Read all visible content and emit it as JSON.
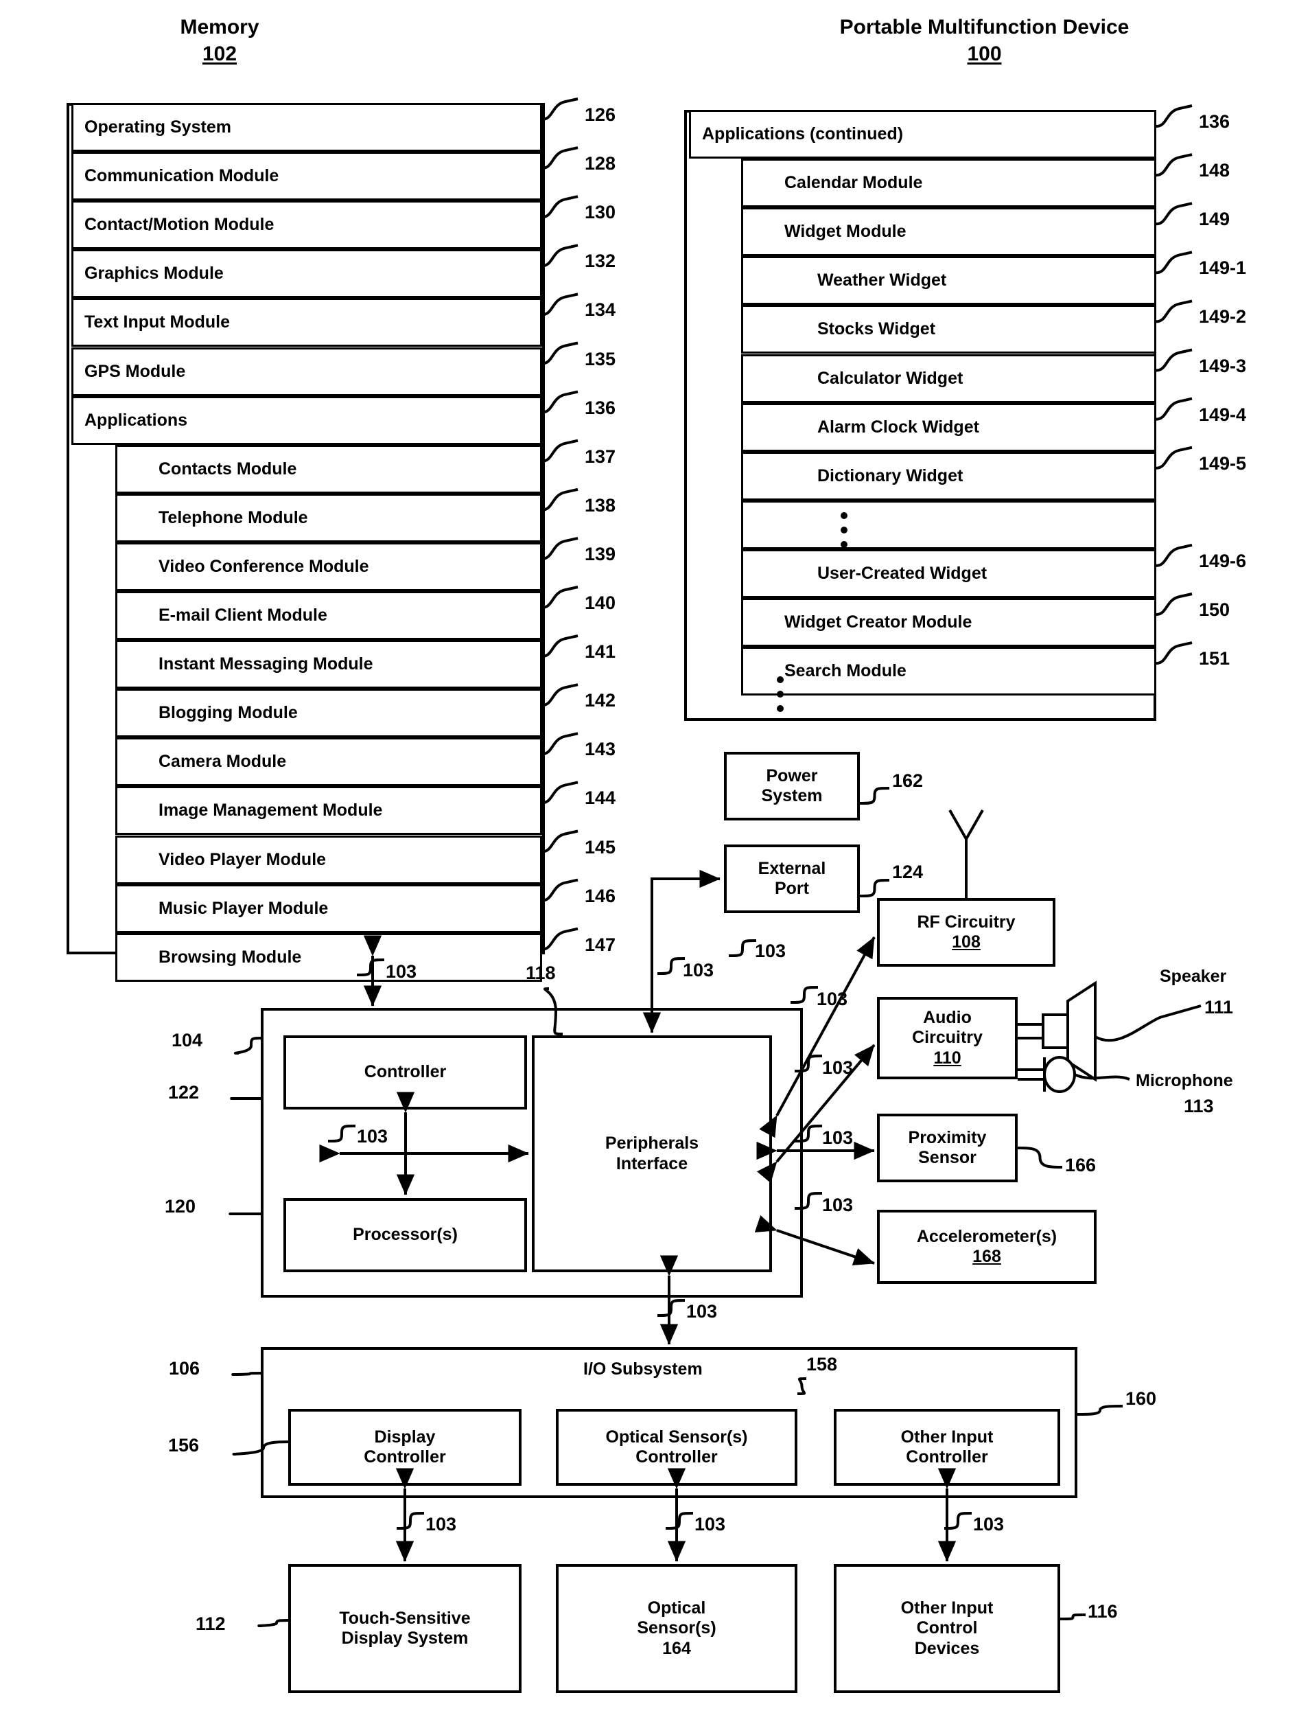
{
  "headings": {
    "memory": {
      "title": "Memory",
      "ref": "102"
    },
    "device": {
      "title": "Portable Multifunction Device",
      "ref": "100"
    }
  },
  "memory_panel": {
    "rows": [
      {
        "label": "Operating System",
        "ref": "126",
        "indent": 0
      },
      {
        "label": "Communication Module",
        "ref": "128",
        "indent": 0
      },
      {
        "label": "Contact/Motion Module",
        "ref": "130",
        "indent": 0
      },
      {
        "label": "Graphics Module",
        "ref": "132",
        "indent": 0
      },
      {
        "label": "Text Input Module",
        "ref": "134",
        "indent": 0
      },
      {
        "label": "GPS Module",
        "ref": "135",
        "indent": 0
      },
      {
        "label": "Applications",
        "ref": "136",
        "indent": 0
      },
      {
        "label": "Contacts Module",
        "ref": "137",
        "indent": 1
      },
      {
        "label": "Telephone Module",
        "ref": "138",
        "indent": 1
      },
      {
        "label": "Video Conference Module",
        "ref": "139",
        "indent": 1
      },
      {
        "label": "E-mail Client Module",
        "ref": "140",
        "indent": 1
      },
      {
        "label": "Instant Messaging Module",
        "ref": "141",
        "indent": 1
      },
      {
        "label": "Blogging Module",
        "ref": "142",
        "indent": 1
      },
      {
        "label": "Camera Module",
        "ref": "143",
        "indent": 1
      },
      {
        "label": "Image Management Module",
        "ref": "144",
        "indent": 1
      },
      {
        "label": "Video Player Module",
        "ref": "145",
        "indent": 1
      },
      {
        "label": "Music Player Module",
        "ref": "146",
        "indent": 1
      },
      {
        "label": "Browsing Module",
        "ref": "147",
        "indent": 1
      }
    ]
  },
  "applications_panel": {
    "rows": [
      {
        "label": "Applications (continued)",
        "ref": "136",
        "indent": 0
      },
      {
        "label": "Calendar Module",
        "ref": "148",
        "indent": 1
      },
      {
        "label": "Widget Module",
        "ref": "149",
        "indent": 1
      },
      {
        "label": "Weather Widget",
        "ref": "149-1",
        "indent": 2
      },
      {
        "label": "Stocks Widget",
        "ref": "149-2",
        "indent": 2
      },
      {
        "label": "Calculator Widget",
        "ref": "149-3",
        "indent": 2
      },
      {
        "label": "Alarm Clock Widget",
        "ref": "149-4",
        "indent": 2
      },
      {
        "label": "Dictionary Widget",
        "ref": "149-5",
        "indent": 2
      },
      {
        "label": "",
        "ref": "",
        "indent": 2,
        "ellipsis": true
      },
      {
        "label": "User-Created Widget",
        "ref": "149-6",
        "indent": 2
      },
      {
        "label": "Widget Creator Module",
        "ref": "150",
        "indent": 1
      },
      {
        "label": "Search Module",
        "ref": "151",
        "indent": 1
      }
    ]
  },
  "blocks": {
    "power_system": {
      "label": "Power\nSystem",
      "ref": "162"
    },
    "external_port": {
      "label": "External\nPort",
      "ref": "124"
    },
    "rf_circuitry": {
      "label": "RF Circuitry",
      "num": "108"
    },
    "audio_circuitry": {
      "label": "Audio\nCircuitry",
      "num": "110"
    },
    "proximity_sensor": {
      "label": "Proximity\nSensor",
      "ref": "166"
    },
    "accelerometers": {
      "label": "Accelerometer(s)",
      "num": "168"
    },
    "controller": {
      "label": "Controller",
      "ref": "122"
    },
    "processors": {
      "label": "Processor(s)",
      "ref": "120"
    },
    "peripherals": {
      "label": "Peripherals\nInterface",
      "ref": "118"
    },
    "cpu_group": {
      "ref": "104"
    },
    "io_subsystem": {
      "label": "I/O Subsystem",
      "ref": "158",
      "group_ref": "106"
    },
    "display_controller": {
      "label": "Display\nController",
      "ref": "156"
    },
    "optical_sensor_controller": {
      "label": "Optical Sensor(s)\nController",
      "ref": ""
    },
    "other_input_controller": {
      "label": "Other Input\nController",
      "ref": "160"
    },
    "touch_display": {
      "label": "Touch-Sensitive\nDisplay System",
      "ref": "112"
    },
    "optical_sensors": {
      "label": "Optical\nSensor(s)",
      "num": "164"
    },
    "other_input_devices": {
      "label": "Other Input\nControl\nDevices",
      "ref": "116"
    }
  },
  "peripheral_labels": {
    "speaker": {
      "name": "Speaker",
      "ref": "111"
    },
    "microphone": {
      "name": "Microphone",
      "ref": "113"
    }
  },
  "bus_refs": {
    "memory_to_cpu": "103",
    "peripherals_top": "103",
    "external_port_bus": "103",
    "controller_processor": "103",
    "rf_bus": "103",
    "audio_bus": "103",
    "proximity_bus": "103",
    "accelerometer_bus": "103",
    "io_bus": "103",
    "display_bus": "103",
    "optical_bus": "103",
    "other_input_bus": "103"
  }
}
